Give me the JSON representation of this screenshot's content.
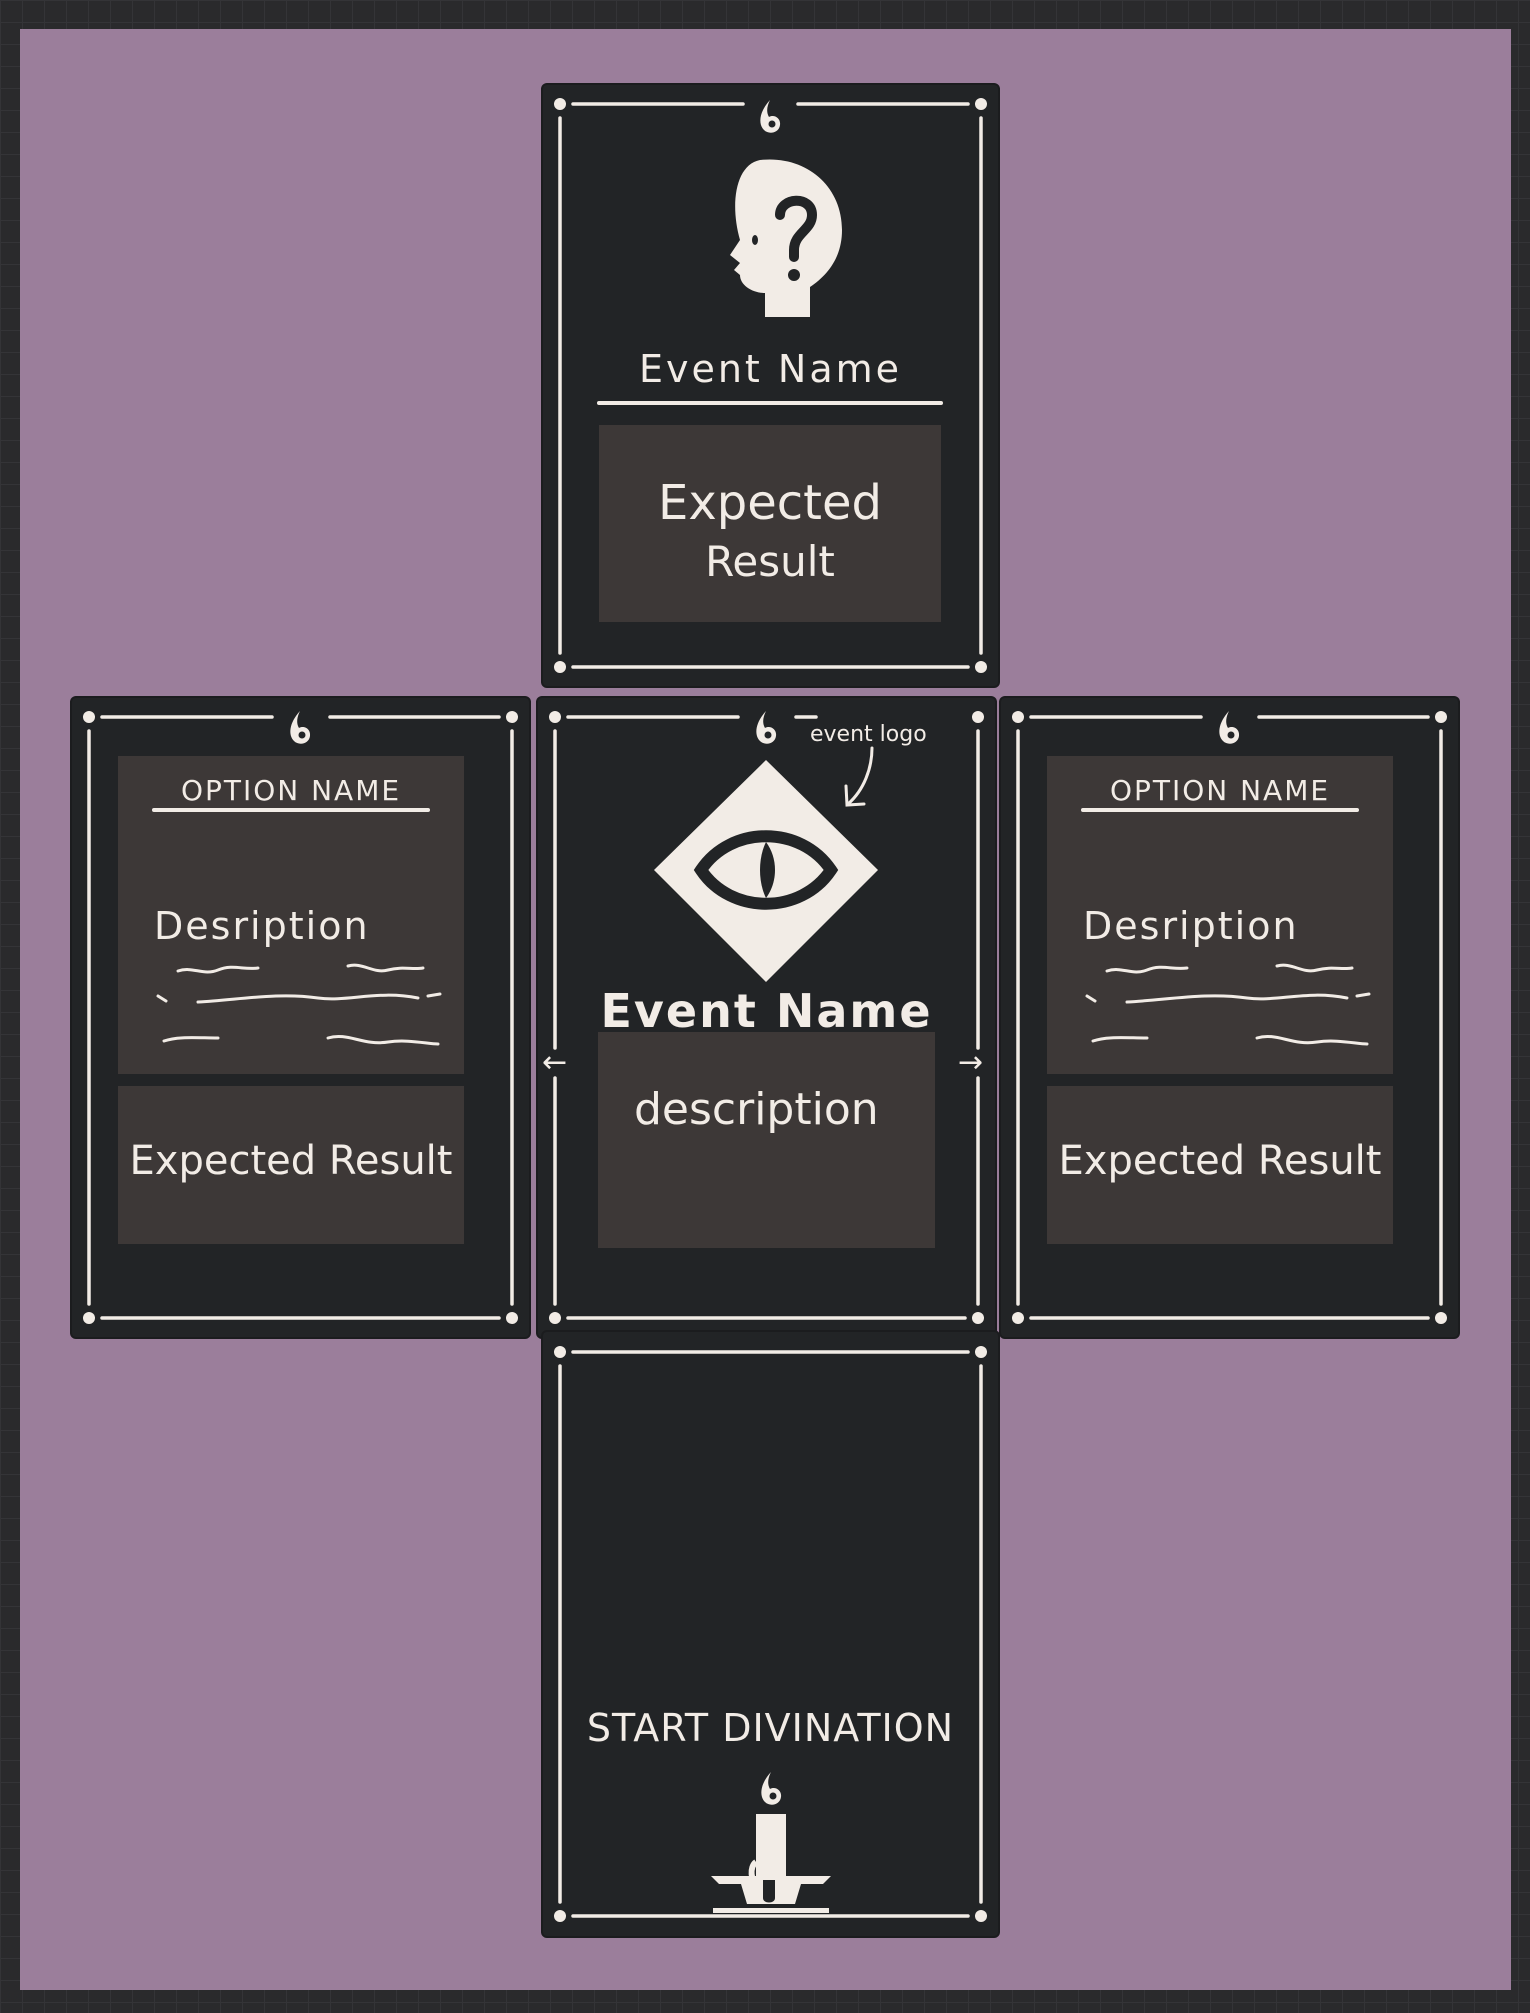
{
  "top_card": {
    "event_name": "Event Name",
    "expected_result_line1": "Expected",
    "expected_result_line2": "Result",
    "icon": "mystery-head-icon"
  },
  "center_card": {
    "event_name": "Event Name",
    "description": "description",
    "annotation": "event logo",
    "icon": "eye-diamond-icon",
    "left_arrow": "←",
    "right_arrow": "→"
  },
  "left_card": {
    "option_name": "OPTION NAME",
    "description": "Desription",
    "expected_result": "Expected Result"
  },
  "right_card": {
    "option_name": "OPTION NAME",
    "description": "Desription",
    "expected_result": "Expected Result"
  },
  "bottom_card": {
    "label": "START DIVINATION",
    "icon": "candle-icon"
  },
  "colors": {
    "background": "#9b7e9b",
    "card": "#222426",
    "panel": "#3d3837",
    "ink": "#f2ece6"
  }
}
